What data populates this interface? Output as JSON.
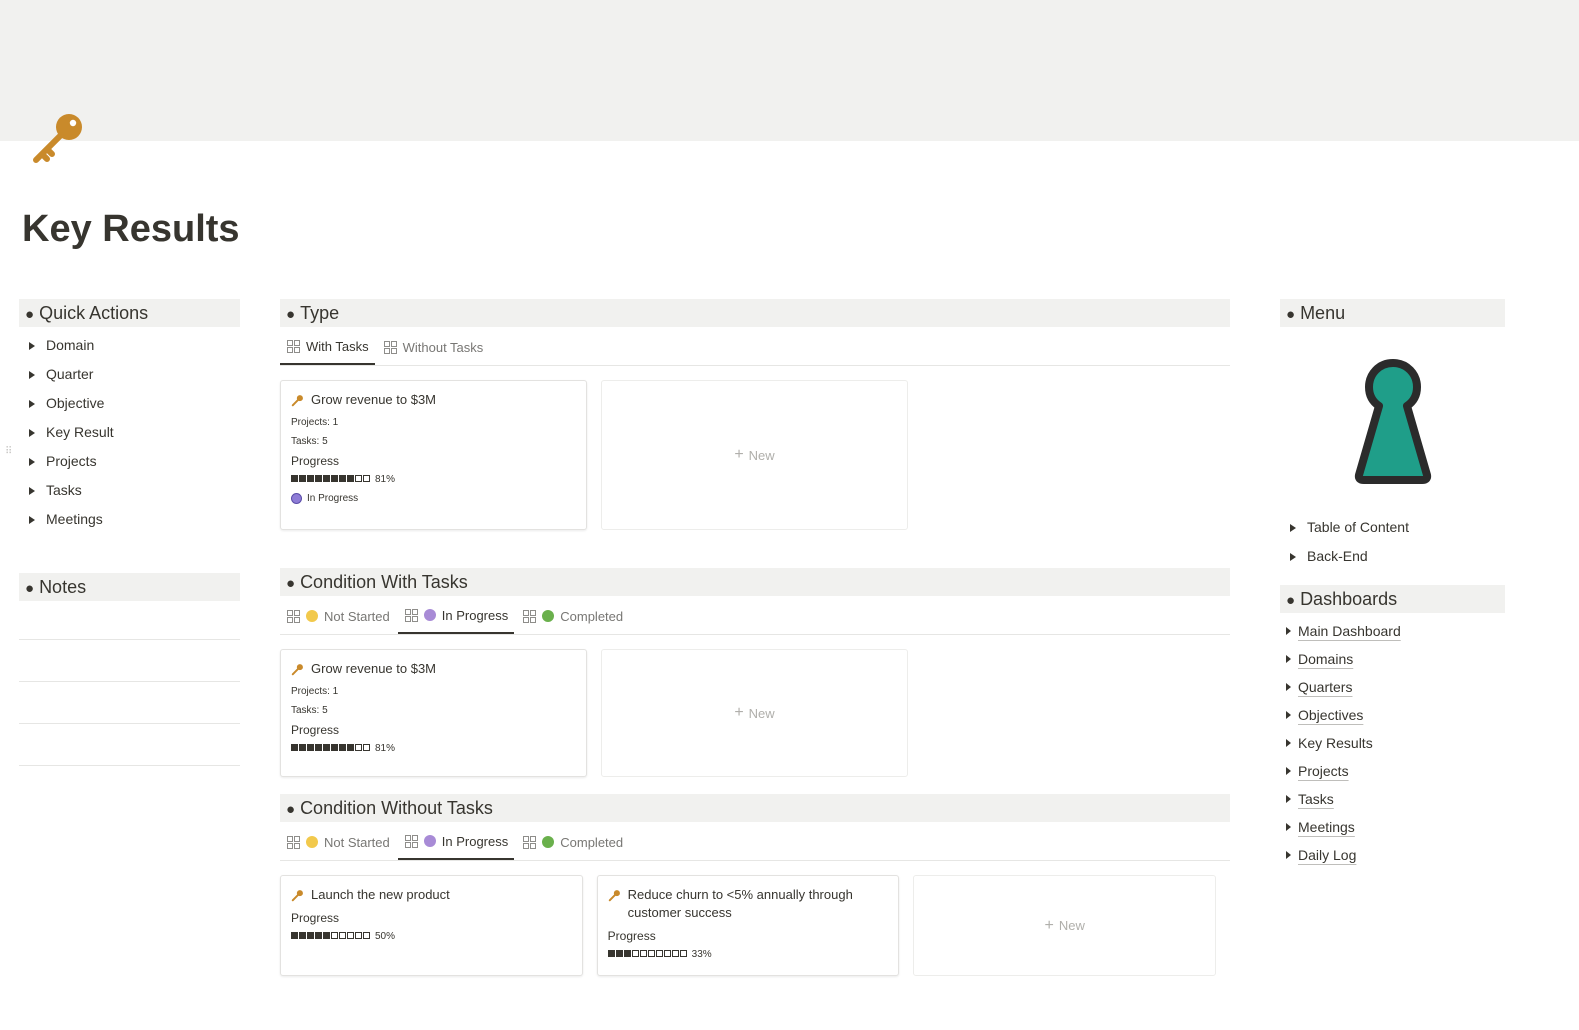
{
  "page": {
    "title": "Key Results",
    "icon": "key-icon"
  },
  "quick_actions": {
    "title": "Quick Actions",
    "items": [
      {
        "label": "Domain"
      },
      {
        "label": "Quarter"
      },
      {
        "label": "Objective"
      },
      {
        "label": "Key Result"
      },
      {
        "label": "Projects"
      },
      {
        "label": "Tasks"
      },
      {
        "label": "Meetings"
      }
    ]
  },
  "notes": {
    "title": "Notes"
  },
  "type_section": {
    "title": "Type",
    "tabs": [
      {
        "label": "With Tasks",
        "active": true
      },
      {
        "label": "Without Tasks",
        "active": false
      }
    ],
    "cards": [
      {
        "title": "Grow revenue to $3M",
        "projects": "Projects: 1",
        "tasks": "Tasks: 5",
        "progress_label": "Progress",
        "progress_filled": 8,
        "progress_total": 10,
        "progress_text": "81%",
        "status": "In Progress"
      }
    ],
    "new_label": "New"
  },
  "condition_with_tasks": {
    "title": "Condition With Tasks",
    "tabs": [
      {
        "label": "Not Started",
        "color": "#f2c94c"
      },
      {
        "label": "In Progress",
        "color": "#a88bd6",
        "active": true
      },
      {
        "label": "Completed",
        "color": "#6ab04c"
      }
    ],
    "cards": [
      {
        "title": "Grow revenue to $3M",
        "projects": "Projects: 1",
        "tasks": "Tasks: 5",
        "progress_label": "Progress",
        "progress_filled": 8,
        "progress_total": 10,
        "progress_text": "81%"
      }
    ],
    "new_label": "New"
  },
  "condition_without_tasks": {
    "title": "Condition Without Tasks",
    "tabs": [
      {
        "label": "Not Started",
        "color": "#f2c94c"
      },
      {
        "label": "In Progress",
        "color": "#a88bd6",
        "active": true
      },
      {
        "label": "Completed",
        "color": "#6ab04c"
      }
    ],
    "cards": [
      {
        "title": "Launch the new product",
        "progress_label": "Progress",
        "progress_filled": 5,
        "progress_total": 10,
        "progress_text": "50%"
      },
      {
        "title": "Reduce churn to <5% annually through customer success",
        "progress_label": "Progress",
        "progress_filled": 3,
        "progress_total": 10,
        "progress_text": "33%"
      }
    ],
    "new_label": "New"
  },
  "menu": {
    "title": "Menu",
    "art": "keyhole-icon",
    "items": [
      {
        "label": "Table of Content"
      },
      {
        "label": "Back-End"
      }
    ]
  },
  "dashboards": {
    "title": "Dashboards",
    "items": [
      {
        "label": "Main Dashboard",
        "link": true
      },
      {
        "label": "Domains",
        "link": true
      },
      {
        "label": "Quarters",
        "link": true
      },
      {
        "label": "Objectives",
        "link": true
      },
      {
        "label": "Key Results",
        "link": false
      },
      {
        "label": "Projects",
        "link": true
      },
      {
        "label": "Tasks",
        "link": true
      },
      {
        "label": "Meetings",
        "link": true
      },
      {
        "label": "Daily Log",
        "link": true
      }
    ]
  },
  "colors": {
    "accent_key": "#c98a2b",
    "keyhole_fill": "#1f9e89",
    "keyhole_stroke": "#2b2b2b",
    "in_progress": "#8e7cd6"
  }
}
